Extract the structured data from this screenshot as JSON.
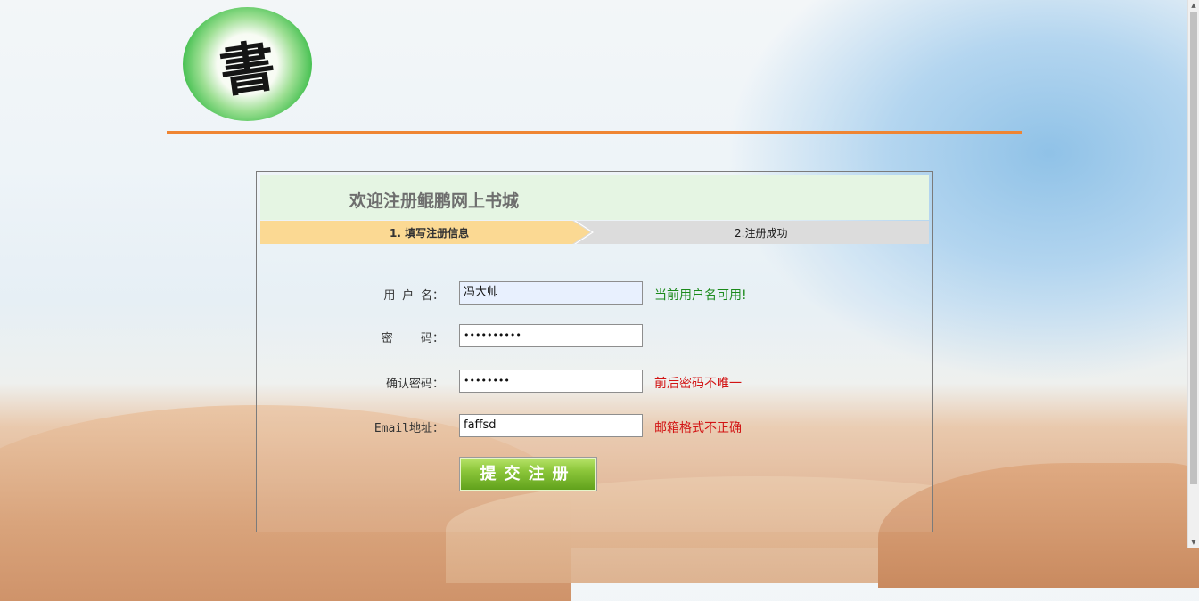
{
  "logo": {
    "glyph": "書"
  },
  "welcome": {
    "title": "欢迎注册鲲鹏网上书城"
  },
  "steps": [
    {
      "label": "1. 填写注册信息",
      "active": true
    },
    {
      "label": "2.注册成功",
      "active": false
    }
  ],
  "form": {
    "username": {
      "label": "用 户 名：",
      "value": "冯大帅",
      "message": "当前用户名可用!",
      "status": "ok"
    },
    "password": {
      "label": "密    码：",
      "value": "••••••••••"
    },
    "confirm": {
      "label": "确认密码：",
      "value": "••••••••",
      "message": "前后密码不唯一",
      "status": "error"
    },
    "email": {
      "label": "Email地址：",
      "value": "faffsd",
      "message": "邮箱格式不正确",
      "status": "error"
    },
    "submit_label": "提交注册"
  },
  "colors": {
    "accent_rule": "#ef8533",
    "active_step": "#fbd993",
    "ok_text": "#1a8a1a",
    "error_text": "#d21414",
    "submit_green": "#7cbf2e"
  }
}
